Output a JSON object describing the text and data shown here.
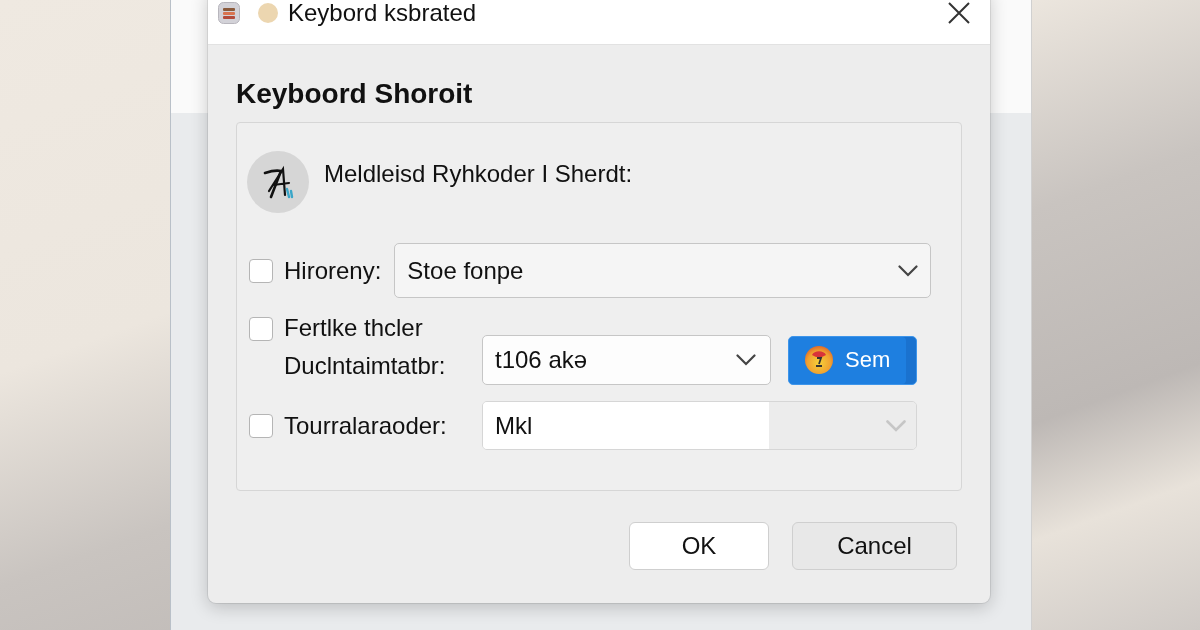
{
  "window": {
    "title": "Keybord ksbrated"
  },
  "heading": "Keyboord Shoroit",
  "intro": "Meldleisd Ryhkoder I Sherdt:",
  "rows": [
    {
      "checked": false,
      "label": "Hiroreny:",
      "field": {
        "kind": "dropdown",
        "value": "Stoe fonpe"
      }
    },
    {
      "checked": false,
      "label": "Fertlke thcler Duclntaimtatbr:",
      "field": {
        "kind": "dropdown",
        "value": "t106 akə"
      },
      "button": {
        "label": "Sem"
      }
    },
    {
      "checked": false,
      "label": "Tourralaraoder:",
      "field": {
        "kind": "combo",
        "value": "Mkl",
        "arrow_disabled": true
      }
    }
  ],
  "buttons": [
    {
      "label": "OK",
      "default": true
    },
    {
      "label": "Cancel",
      "default": false
    }
  ]
}
